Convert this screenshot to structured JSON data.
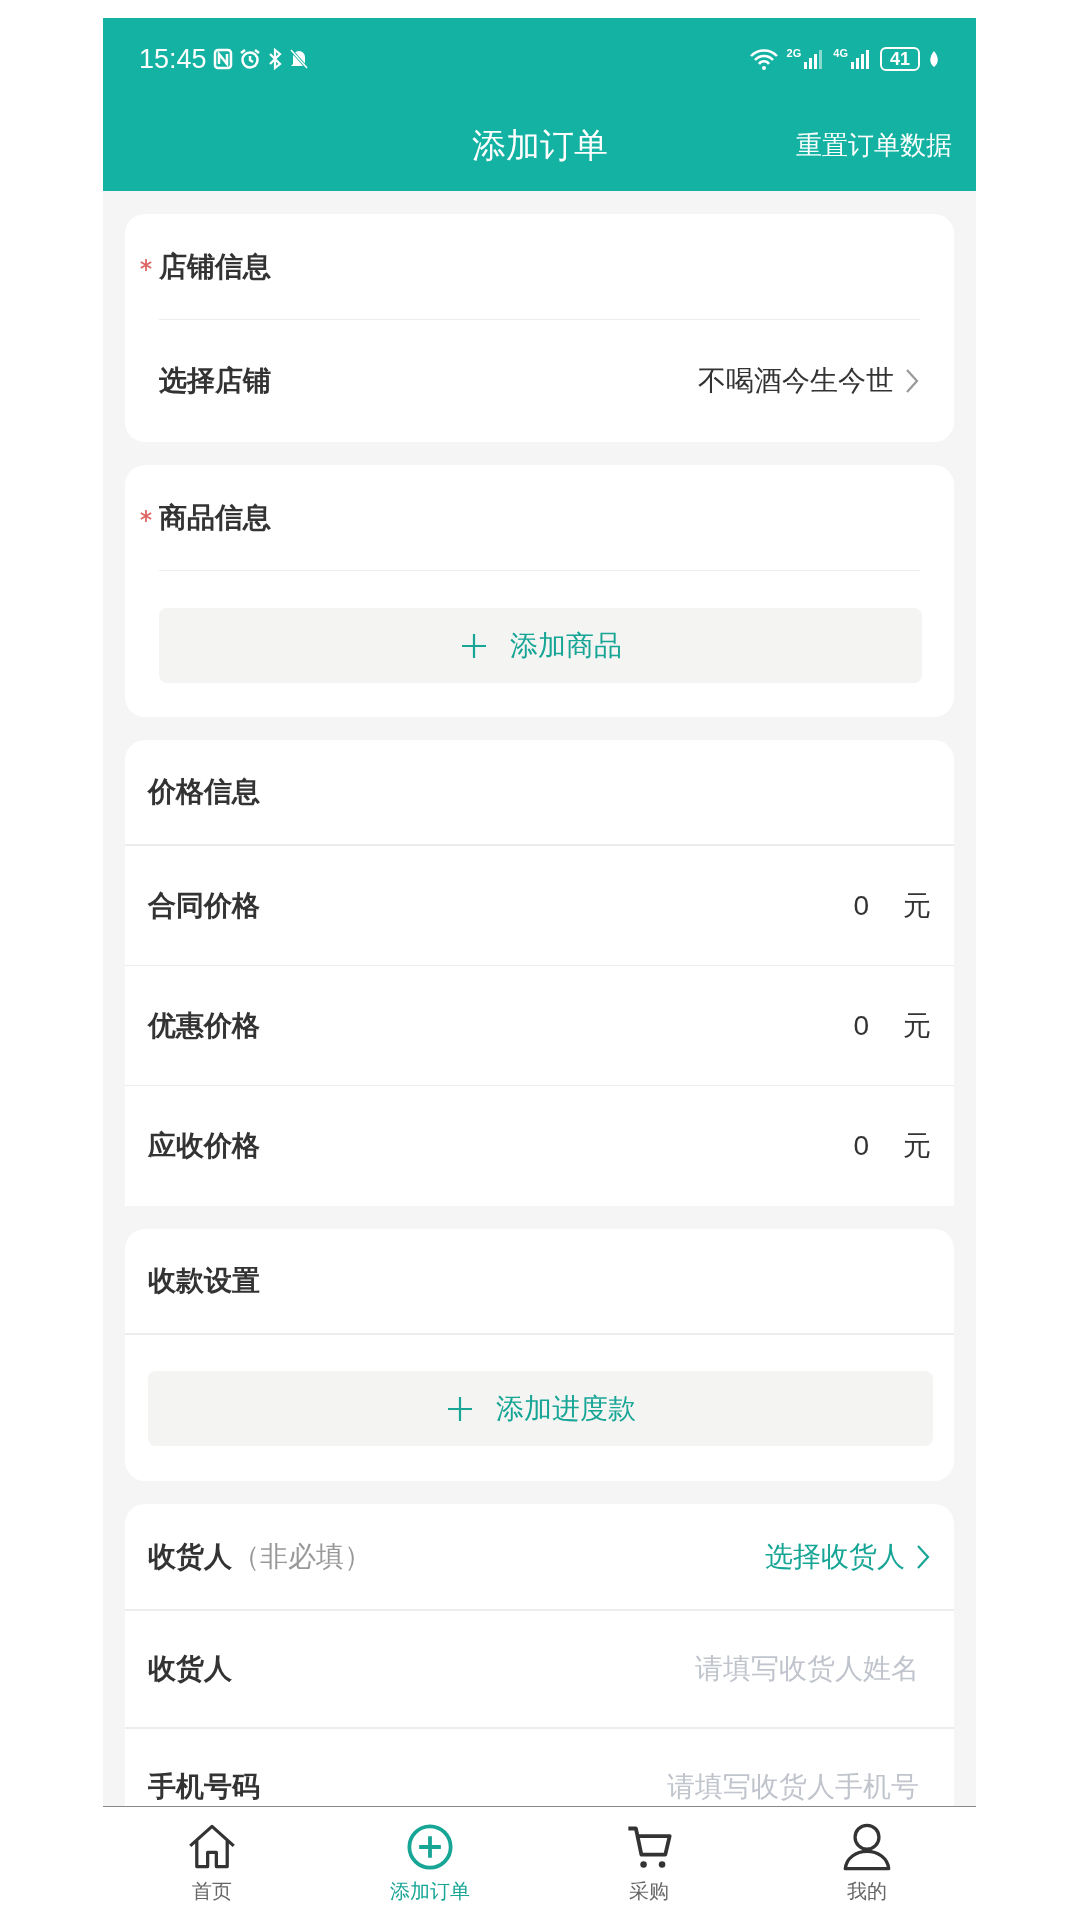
{
  "status_bar": {
    "time": "15:45",
    "network_1": "2G",
    "network_2": "4G",
    "battery": "41"
  },
  "header": {
    "title": "添加订单",
    "action": "重置订单数据"
  },
  "store_section": {
    "title": "店铺信息",
    "required": true,
    "field": {
      "label": "选择店铺",
      "value": "不喝酒今生今世"
    }
  },
  "goods_section": {
    "title": "商品信息",
    "required": true,
    "add_button": "添加商品"
  },
  "price_section": {
    "title": "价格信息",
    "rows": [
      {
        "label": "合同价格",
        "value": "0",
        "unit": "元"
      },
      {
        "label": "优惠价格",
        "value": "0",
        "unit": "元"
      },
      {
        "label": "应收价格",
        "value": "0",
        "unit": "元"
      }
    ]
  },
  "payment_section": {
    "title": "收款设置",
    "add_button": "添加进度款"
  },
  "consignee_section": {
    "title": "收货人",
    "note": "（非必填）",
    "action": "选择收货人",
    "fields": [
      {
        "label": "收货人",
        "placeholder": "请填写收货人姓名"
      },
      {
        "label": "手机号码",
        "placeholder": "请填写收货人手机号"
      }
    ]
  },
  "tab_bar": [
    {
      "kind": "home",
      "label": "首页",
      "selected": false
    },
    {
      "kind": "add",
      "label": "添加订单",
      "selected": true
    },
    {
      "kind": "cart",
      "label": "采购",
      "selected": false
    },
    {
      "kind": "user",
      "label": "我的",
      "selected": false
    }
  ]
}
